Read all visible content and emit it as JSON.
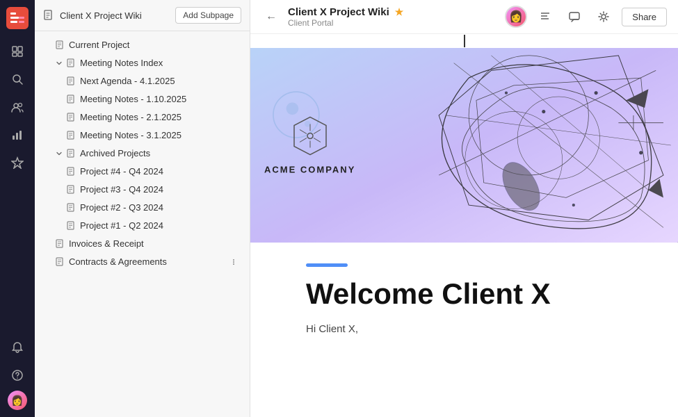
{
  "app": {
    "logo": "S",
    "logo_bg": "#e74c3c"
  },
  "icon_bar": {
    "items": [
      {
        "name": "pages-icon",
        "symbol": "☰",
        "active": false
      },
      {
        "name": "search-icon",
        "symbol": "🔍",
        "active": false
      },
      {
        "name": "people-icon",
        "symbol": "👥",
        "active": false
      },
      {
        "name": "chart-icon",
        "symbol": "📊",
        "active": false
      },
      {
        "name": "star-nav-icon",
        "symbol": "★",
        "active": false
      },
      {
        "name": "bell-icon",
        "symbol": "🔔",
        "active": false
      }
    ],
    "bottom": [
      {
        "name": "help-icon",
        "symbol": "?"
      },
      {
        "name": "user-avatar-icon",
        "symbol": "👤"
      }
    ]
  },
  "sidebar": {
    "add_subpage_label": "Add Subpage",
    "wiki_icon": "☰",
    "wiki_title": "Client X Project Wiki",
    "items": [
      {
        "id": "current-project",
        "label": "Current Project",
        "indent": 1,
        "icon": "☰",
        "has_toggle": false
      },
      {
        "id": "meeting-notes-index",
        "label": "Meeting Notes Index",
        "indent": 1,
        "icon": "☰",
        "has_toggle": true,
        "expanded": true
      },
      {
        "id": "next-agenda",
        "label": "Next Agenda - 4.1.2025",
        "indent": 2,
        "icon": "☰",
        "has_toggle": false
      },
      {
        "id": "meeting-notes-1",
        "label": "Meeting Notes - 1.10.2025",
        "indent": 2,
        "icon": "☰",
        "has_toggle": false
      },
      {
        "id": "meeting-notes-2",
        "label": "Meeting Notes - 2.1.2025",
        "indent": 2,
        "icon": "☰",
        "has_toggle": false
      },
      {
        "id": "meeting-notes-3",
        "label": "Meeting Notes - 3.1.2025",
        "indent": 2,
        "icon": "☰",
        "has_toggle": false
      },
      {
        "id": "archived-projects",
        "label": "Archived Projects",
        "indent": 1,
        "icon": "☰",
        "has_toggle": true,
        "expanded": true
      },
      {
        "id": "project-4",
        "label": "Project #4 - Q4 2024",
        "indent": 2,
        "icon": "☰",
        "has_toggle": false
      },
      {
        "id": "project-3",
        "label": "Project #3 - Q4 2024",
        "indent": 2,
        "icon": "☰",
        "has_toggle": false
      },
      {
        "id": "project-2",
        "label": "Project #2 - Q3 2024",
        "indent": 2,
        "icon": "☰",
        "has_toggle": false
      },
      {
        "id": "project-1",
        "label": "Project #1 - Q2 2024",
        "indent": 2,
        "icon": "☰",
        "has_toggle": false
      },
      {
        "id": "invoices",
        "label": "Invoices & Receipt",
        "indent": 1,
        "icon": "☰",
        "has_toggle": false
      },
      {
        "id": "contracts",
        "label": "Contracts & Agreements",
        "indent": 1,
        "icon": "☰",
        "has_toggle": false
      }
    ]
  },
  "topbar": {
    "back_icon": "←",
    "page_title": "Client X Project Wiki",
    "star_icon": "★",
    "breadcrumb": "Client Portal",
    "avatar_emoji": "👩",
    "list_icon": "☰",
    "comment_icon": "💬",
    "settings_icon": "⚙",
    "share_label": "Share"
  },
  "document": {
    "hero": {
      "company_name": "ACME COMPANY"
    },
    "accent_bar_color": "#4f8ef7",
    "welcome_title": "Welcome Client X",
    "welcome_text": "Hi Client X,"
  }
}
